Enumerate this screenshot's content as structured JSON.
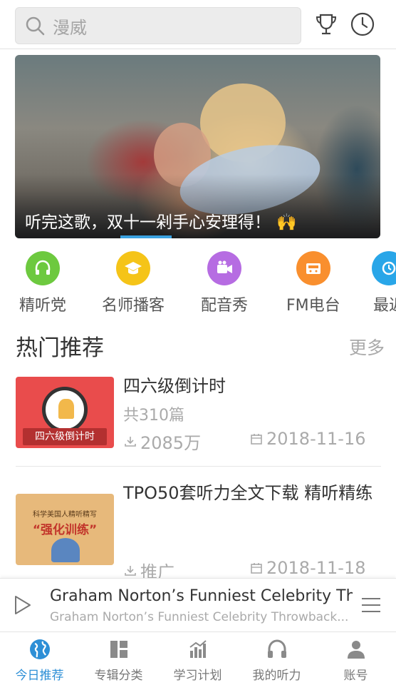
{
  "search": {
    "placeholder": "漫威"
  },
  "header_icons": [
    "trophy-icon",
    "clock-icon"
  ],
  "banner": {
    "caption": "听完这歌，双十一剁手心安理得！",
    "emoji": "🙌"
  },
  "categories": [
    {
      "label": "精听党",
      "icon": "headphones-icon",
      "color": "#6dc93f"
    },
    {
      "label": "名师播客",
      "icon": "graduation-cap-icon",
      "color": "#f5c418"
    },
    {
      "label": "配音秀",
      "icon": "video-camera-icon",
      "color": "#b66ce2"
    },
    {
      "label": "FM电台",
      "icon": "radio-icon",
      "color": "#f98f2e"
    },
    {
      "label": "最近",
      "icon": "recent-icon",
      "color": "#29a6e8"
    }
  ],
  "section": {
    "title": "热门推荐",
    "more": "更多"
  },
  "items": [
    {
      "title": "四六级倒计时",
      "sub": "共310篇",
      "count": "2085万",
      "date": "2018-11-16",
      "thumb_tag": "四六级倒计时"
    },
    {
      "title": "TPO50套听力全文下载 精听精练",
      "sub": "",
      "count": "推广",
      "date": "2018-11-18",
      "thumb_top": "科学美国人精听精写",
      "thumb_big": "“强化训练”"
    }
  ],
  "player": {
    "title": "Graham Norton’s Funniest Celebrity Throwbacks",
    "subtitle": "Graham Norton’s Funniest Celebrity Throwback..."
  },
  "tabs": [
    {
      "label": "今日推荐",
      "icon": "globe-icon",
      "active": true
    },
    {
      "label": "专辑分类",
      "icon": "category-icon",
      "active": false
    },
    {
      "label": "学习计划",
      "icon": "chart-icon",
      "active": false
    },
    {
      "label": "我的听力",
      "icon": "headphones-icon",
      "active": false
    },
    {
      "label": "账号",
      "icon": "user-icon",
      "active": false
    }
  ],
  "colors": {
    "accent": "#2d8fd6",
    "indicator": "#3aa1e0"
  }
}
